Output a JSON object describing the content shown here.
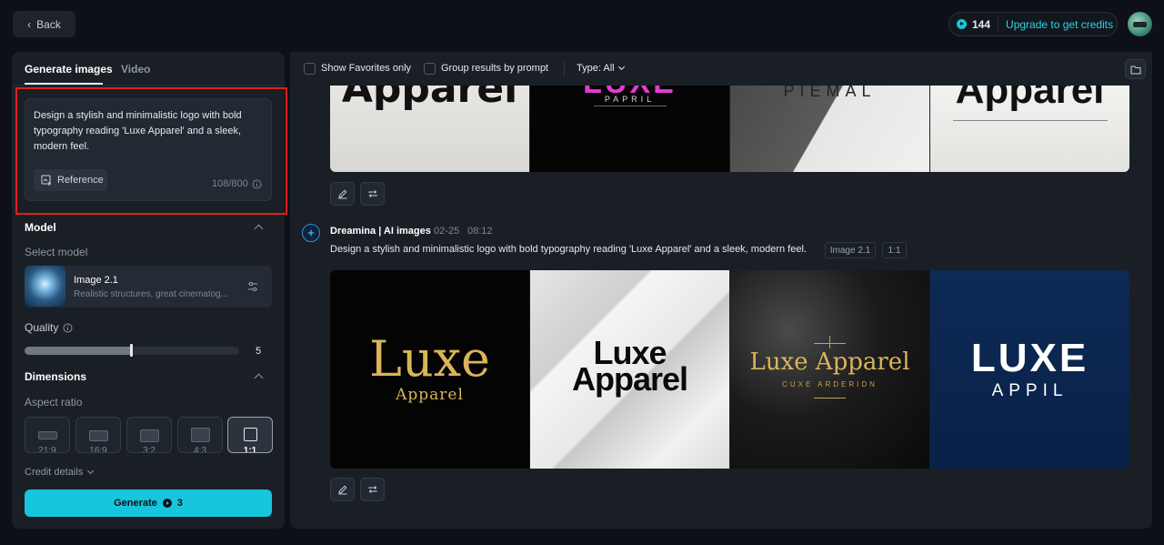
{
  "header": {
    "back_label": "Back",
    "credits": "144",
    "upgrade_label": "Upgrade to get credits"
  },
  "sidebar": {
    "tabs": [
      {
        "label": "Generate images",
        "active": true
      },
      {
        "label": "Video",
        "active": false
      }
    ],
    "prompt": {
      "text": "Design a stylish and minimalistic logo with bold typography reading 'Luxe Apparel' and a sleek, modern feel.",
      "reference_label": "Reference",
      "char_count": "108/800"
    },
    "model": {
      "section_title": "Model",
      "select_label": "Select model",
      "name": "Image 2.1",
      "description": "Realistic structures, great cinematog..."
    },
    "quality": {
      "label": "Quality",
      "value": "5",
      "fraction": 0.5
    },
    "dimensions": {
      "section_title": "Dimensions",
      "aspect_label": "Aspect ratio",
      "ratios": [
        "21:9",
        "16:9",
        "3:2",
        "4:3",
        "1:1"
      ],
      "selected": "1:1"
    },
    "credit_details_label": "Credit details",
    "generate": {
      "label": "Generate",
      "cost": "3"
    }
  },
  "filters": {
    "favorites_label": "Show Favorites only",
    "group_label": "Group results by prompt",
    "type_label": "Type: All"
  },
  "results": [
    {
      "images": [
        {
          "text": "Apparel"
        },
        {
          "text": "LUXE",
          "sub": "PAPRIL"
        },
        {
          "text": "PIEMAL"
        },
        {
          "text": "Apparel"
        }
      ]
    },
    {
      "source": "Dreamina | AI images",
      "date": "02-25",
      "time": "08:12",
      "prompt": "Design a stylish and minimalistic logo with bold typography reading 'Luxe Apparel' and a sleek, modern feel.",
      "model_tag": "Image 2.1",
      "ratio_tag": "1:1",
      "images": [
        {
          "text": "Luxe",
          "sub": "Apparel"
        },
        {
          "text": "Luxe",
          "sub": "Apparel"
        },
        {
          "text": "Luxe Apparel",
          "sub": "CUXE ARDERIDN"
        },
        {
          "text": "LUXE",
          "sub": "APPIL"
        }
      ]
    }
  ],
  "colors": {
    "accent": "#17c6dd",
    "highlight": "#e0201e",
    "background": "#0d1117",
    "panel": "#1a1f26"
  }
}
